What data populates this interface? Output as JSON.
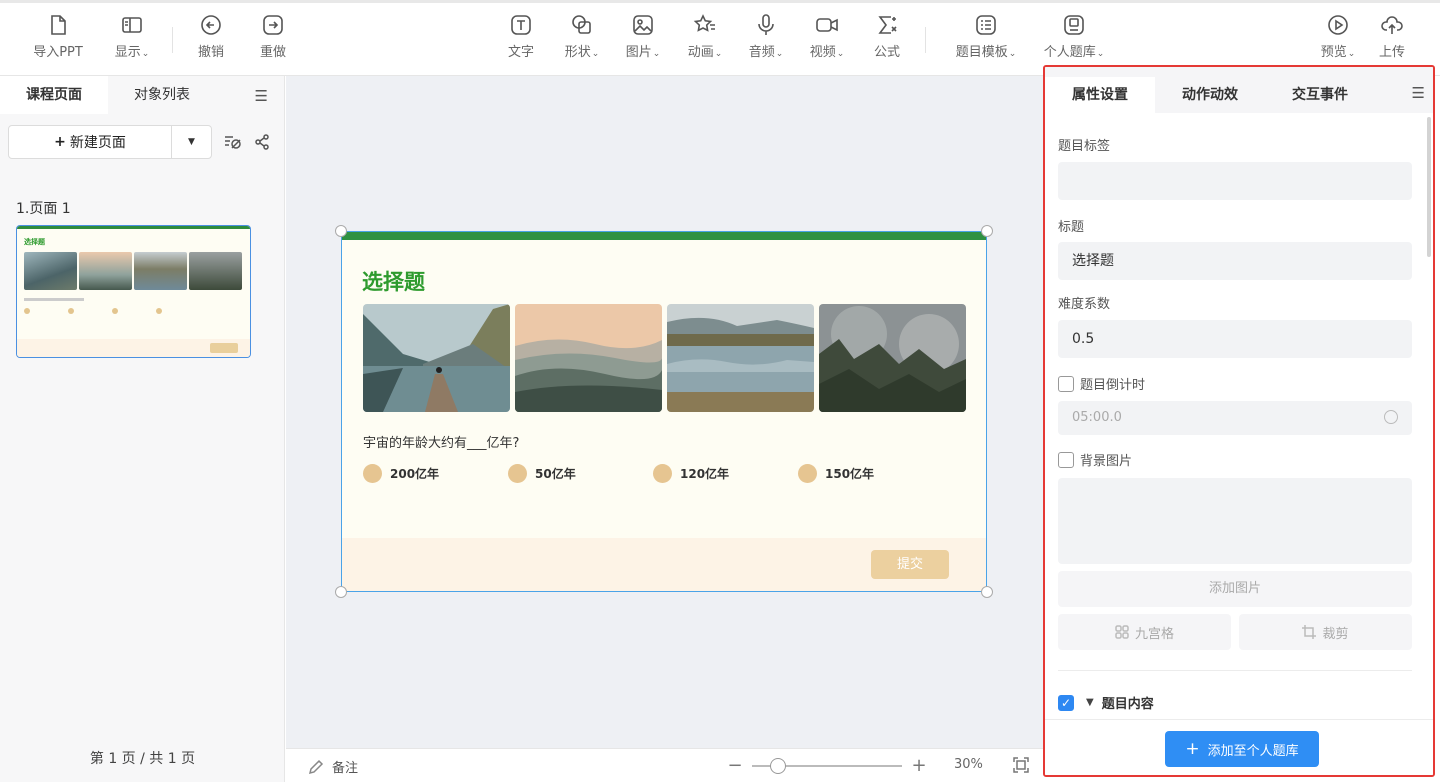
{
  "toolbar": {
    "import_ppt": "导入PPT",
    "display": "显示",
    "undo": "撤销",
    "redo": "重做",
    "text": "文字",
    "shape": "形状",
    "image": "图片",
    "animation": "动画",
    "audio": "音频",
    "video": "视频",
    "formula": "公式",
    "question_template": "题目模板",
    "personal_bank": "个人题库",
    "preview": "预览",
    "upload": "上传",
    "caret": "⌄"
  },
  "left": {
    "tab_pages": "课程页面",
    "tab_objects": "对象列表",
    "new_page": "新建页面",
    "page_label": "1.页面 1",
    "page_count": "第 1 页 / 共 1 页"
  },
  "slide": {
    "title": "选择题",
    "question": "宇宙的年龄大约有___亿年?",
    "options": [
      "200亿年",
      "50亿年",
      "120亿年",
      "150亿年"
    ],
    "submit": "提交"
  },
  "bottom": {
    "note": "备注",
    "zoom": "30%",
    "zoom_level": 0.17
  },
  "right": {
    "tab_props": "属性设置",
    "tab_actions": "动作动效",
    "tab_events": "交互事件",
    "label_tag": "题目标签",
    "tag_value": "",
    "label_title": "标题",
    "title_value": "选择题",
    "label_difficulty": "难度系数",
    "difficulty_value": "0.5",
    "countdown": "题目倒计时",
    "countdown_value": "05:00.0",
    "bg_image": "背景图片",
    "add_image": "添加图片",
    "nine_grid": "九宫格",
    "crop": "裁剪",
    "question_content": "题目内容",
    "add_to_bank": "添加至个人题库"
  },
  "colors": {
    "accent": "#2f8ef4",
    "title_green": "#2e9b2e",
    "highlight_border": "#e53935",
    "option_dot": "#e6c591"
  }
}
